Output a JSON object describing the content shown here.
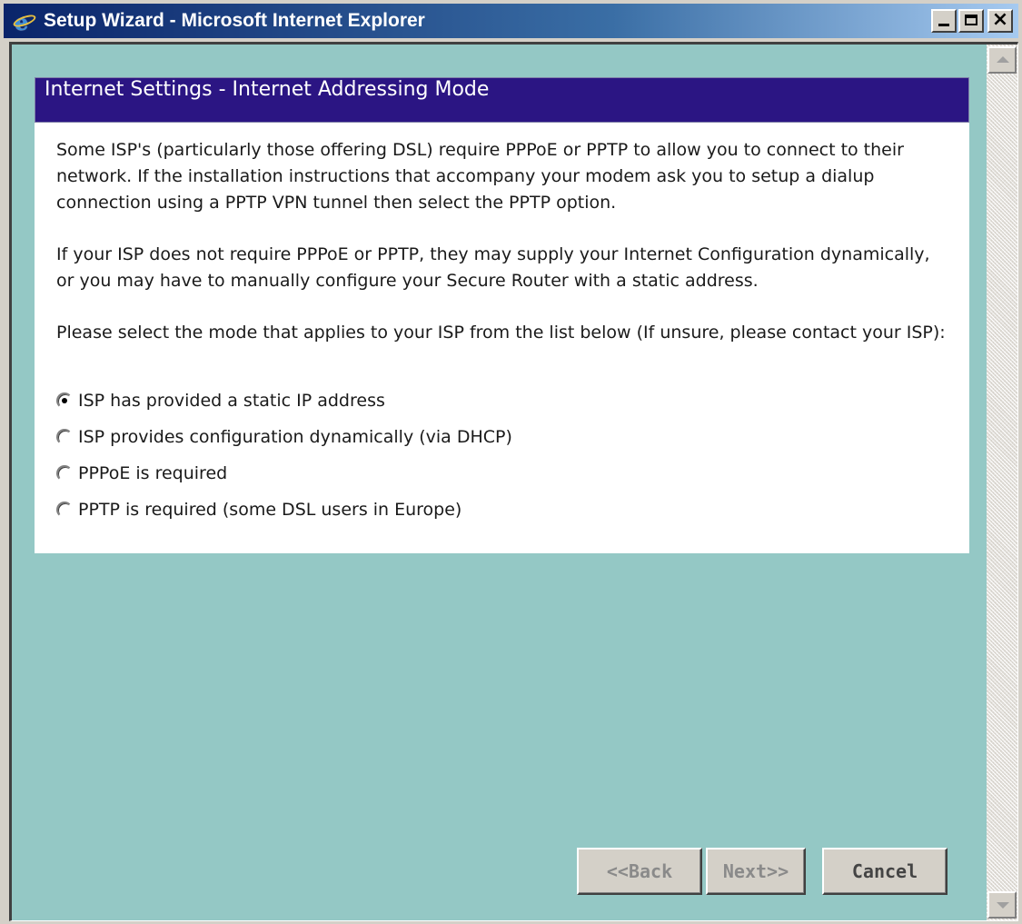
{
  "window": {
    "title": "Setup Wizard - Microsoft Internet Explorer"
  },
  "panel": {
    "heading": "Internet Settings - Internet Addressing Mode",
    "paragraphs": [
      "Some ISP's (particularly those offering DSL) require PPPoE or PPTP to allow you to connect to their network. If the installation instructions that accompany your modem ask you to setup a dialup connection using a PPTP VPN tunnel then select the PPTP option.",
      "If your ISP does not require PPPoE or PPTP, they may supply your Internet Configuration dynamically, or you may have to manually configure your Secure Router with a static address.",
      "Please select the mode that applies to your ISP from the list below (If unsure, please contact your ISP):"
    ],
    "options": [
      {
        "label": "ISP has provided a static IP address",
        "checked": true
      },
      {
        "label": "ISP provides configuration dynamically (via DHCP)",
        "checked": false
      },
      {
        "label": "PPPoE is required",
        "checked": false
      },
      {
        "label": "PPTP is required (some DSL users in Europe)",
        "checked": false
      }
    ]
  },
  "buttons": {
    "back": "<<Back",
    "next": "Next>>",
    "cancel": "Cancel"
  },
  "colors": {
    "titlebar_start": "#0a246a",
    "client_background": "#94c8c5",
    "panel_header": "#2b1583"
  }
}
